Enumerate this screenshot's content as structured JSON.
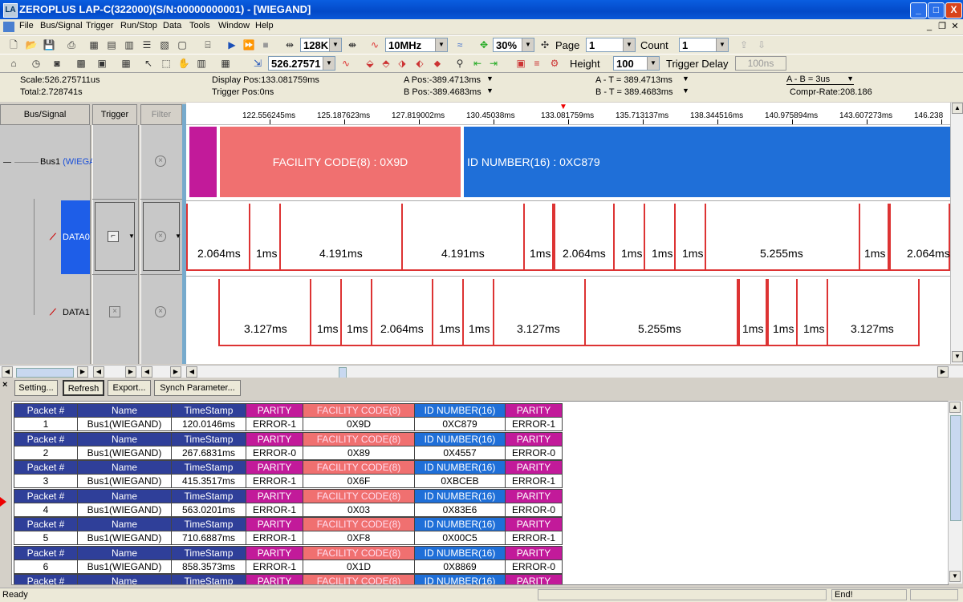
{
  "window": {
    "title": "ZEROPLUS LAP-C(322000)(S/N:00000000001) - [WIEGAND]",
    "app_icon": "LA",
    "min": "_",
    "max": "□",
    "close": "X"
  },
  "menu": [
    "File",
    "Bus/Signal",
    "Trigger",
    "Run/Stop",
    "Data",
    "Tools",
    "Window",
    "Help"
  ],
  "toolbar": {
    "memory": "128K",
    "frequency": "10MHz",
    "zoom": "30%",
    "page_label": "Page",
    "page": "1",
    "count_label": "Count",
    "count": "1",
    "scale_value": "526.27571",
    "height_label": "Height",
    "height": "100",
    "trigger_delay_label": "Trigger Delay",
    "trigger_delay": "100ns"
  },
  "info": {
    "scale": "Scale:526.275711us",
    "total": "Total:2.728741s",
    "display_pos": "Display Pos:133.081759ms",
    "trigger_pos": "Trigger Pos:0ns",
    "a_pos": "A Pos:-389.4713ms",
    "b_pos": "B Pos:-389.4683ms",
    "a_t": "A - T = 389.4713ms",
    "b_t": "B - T = 389.4683ms",
    "a_b": "A - B = 3us",
    "compr_rate": "Compr-Rate:208.186"
  },
  "columns": {
    "bus_signal": "Bus/Signal",
    "trigger": "Trigger",
    "filter": "Filter"
  },
  "signals": {
    "bus1": "Bus1",
    "bus1_suffix": "(WIEGA",
    "data0": "DATA0",
    "data1": "DATA1"
  },
  "ruler_ticks": [
    "122.556245ms",
    "125.187623ms",
    "127.819002ms",
    "130.45038ms",
    "133.081759ms",
    "135.713137ms",
    "138.344516ms",
    "140.975894ms",
    "143.607273ms",
    "146.238"
  ],
  "bus_segments": {
    "facility": "FACILITY CODE(8) : 0X9D",
    "id": "ID NUMBER(16) : 0XC879"
  },
  "data0_labels": [
    "2.064ms",
    "1ms",
    "4.191ms",
    "4.191ms",
    "1ms",
    "2.064ms",
    "1ms",
    "1ms",
    "1ms",
    "5.255ms",
    "1ms",
    "2.064ms"
  ],
  "data1_labels": [
    "3.127ms",
    "1ms",
    "1ms",
    "2.064ms",
    "1ms",
    "1ms",
    "3.127ms",
    "5.255ms",
    "1ms",
    "1ms",
    "1ms",
    "3.127ms"
  ],
  "packet_buttons": {
    "setting": "Setting...",
    "refresh": "Refresh",
    "export": "Export...",
    "synch": "Synch Parameter..."
  },
  "packet_headers": [
    "Packet #",
    "Name",
    "TimeStamp",
    "PARITY",
    "FACILITY CODE(8)",
    "ID NUMBER(16)",
    "PARITY"
  ],
  "packets": [
    {
      "n": "1",
      "name": "Bus1(WIEGAND)",
      "ts": "120.0146ms",
      "p1": "ERROR-1",
      "fc": "0X9D",
      "id": "0XC879",
      "p2": "ERROR-1"
    },
    {
      "n": "2",
      "name": "Bus1(WIEGAND)",
      "ts": "267.6831ms",
      "p1": "ERROR-0",
      "fc": "0X89",
      "id": "0X4557",
      "p2": "ERROR-0"
    },
    {
      "n": "3",
      "name": "Bus1(WIEGAND)",
      "ts": "415.3517ms",
      "p1": "ERROR-1",
      "fc": "0X6F",
      "id": "0XBCEB",
      "p2": "ERROR-1"
    },
    {
      "n": "4",
      "name": "Bus1(WIEGAND)",
      "ts": "563.0201ms",
      "p1": "ERROR-1",
      "fc": "0X03",
      "id": "0X83E6",
      "p2": "ERROR-0"
    },
    {
      "n": "5",
      "name": "Bus1(WIEGAND)",
      "ts": "710.6887ms",
      "p1": "ERROR-1",
      "fc": "0XF8",
      "id": "0X00C5",
      "p2": "ERROR-1"
    },
    {
      "n": "6",
      "name": "Bus1(WIEGAND)",
      "ts": "858.3573ms",
      "p1": "ERROR-1",
      "fc": "0X1D",
      "id": "0X8869",
      "p2": "ERROR-0"
    }
  ],
  "status": {
    "left": "Ready",
    "right": "End!"
  },
  "colors": {
    "facility": "#f07070",
    "id": "#1f6fd8",
    "parity": "#c21a9a",
    "header": "#2f3f99",
    "pulse": "#d33333"
  }
}
